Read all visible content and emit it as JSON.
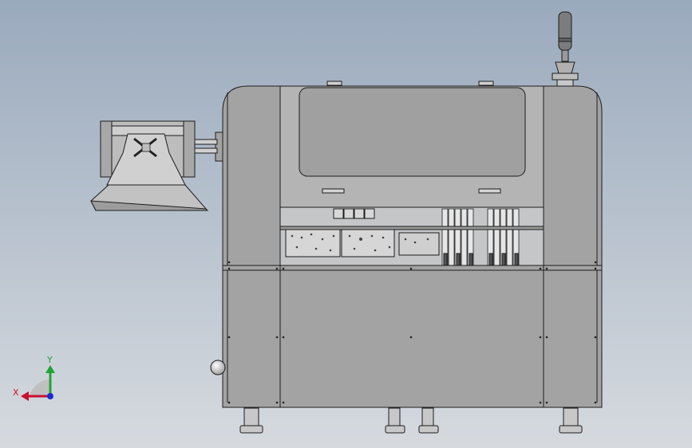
{
  "scene": {
    "background_top": "#9aaabd",
    "background_bottom": "#d6dadf",
    "body_fill": "#a3a3a3",
    "body_fill_light": "#b4b4b4",
    "stroke": "#1c1c1c",
    "monitor_fill": "#bdbdbd",
    "fixture_fill": "#d0d0d0",
    "light_tower_fill": "#7c7c7c"
  },
  "triad": {
    "x_label": "X",
    "y_label": "Y",
    "x_color": "#c8102e",
    "y_color": "#1fa533",
    "z_color": "#1a2bd1"
  },
  "icons": {
    "monitor": "monitor-on-arm",
    "signal_tower": "signal-light-tower",
    "feet": "leveling-foot"
  }
}
